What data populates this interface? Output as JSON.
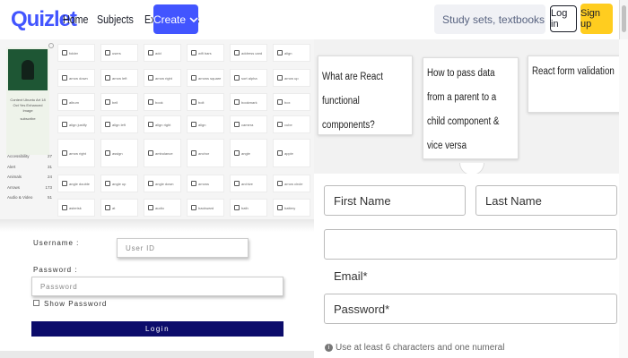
{
  "header": {
    "logo": "Quizlet",
    "nav": [
      "Home",
      "Subjects",
      "Explanations"
    ],
    "create_label": "Create",
    "search_placeholder": "Study sets, textbooks, ...",
    "login_label": "Log in",
    "signup_label": "Sign up",
    "brand_color": "#4255ff",
    "signup_color": "#ffcd1f"
  },
  "icon_panel": {
    "video_caption": "Context Ubuntu Art 18 Oct Yes Enhanced Image",
    "video_sub": "subscribe",
    "sidebar": [
      {
        "label": "Accessibility",
        "count": "27"
      },
      {
        "label": "Alert",
        "count": "31"
      },
      {
        "label": "Animals",
        "count": "24"
      },
      {
        "label": "Arrows",
        "count": "173"
      },
      {
        "label": "Audio & Video",
        "count": "51"
      }
    ],
    "grid": [
      [
        "folder",
        "users",
        "add",
        "wifi bars",
        "address card",
        "align"
      ],
      [
        "arrow down",
        "arrow left",
        "arrow right",
        "arrows square",
        "sort alpha",
        "arrow up"
      ],
      [
        "album",
        "bell",
        "book",
        "bolt",
        "bookmark",
        "box"
      ],
      [
        "align justify",
        "align left",
        "align right",
        "align",
        "camera",
        "cube"
      ],
      [
        "arrow right",
        "assign",
        "ambulance",
        "anchor",
        "angle",
        "apple"
      ],
      [
        "angle double",
        "angle up",
        "angle down",
        "arrows",
        "archive",
        "arrow circle"
      ],
      [
        "asterisk",
        "at",
        "audio",
        "backward",
        "bath",
        "battery"
      ]
    ]
  },
  "login_form": {
    "username_label": "Username :",
    "username_placeholder": "User ID",
    "password_label": "Password :",
    "password_placeholder": "Password",
    "show_password_label": "Show Password",
    "submit_label": "Login",
    "submit_color": "#0c0c6b"
  },
  "cards": [
    {
      "text": "What are React functional components?"
    },
    {
      "text": "How to pass data from a parent to a child component & vice versa"
    },
    {
      "text": "React form validation"
    }
  ],
  "signup_form": {
    "first_name": "First Name",
    "last_name": "Last Name",
    "email_label": "Email*",
    "password": "Password*",
    "hint": "Use at least 6 characters and one numeral"
  }
}
